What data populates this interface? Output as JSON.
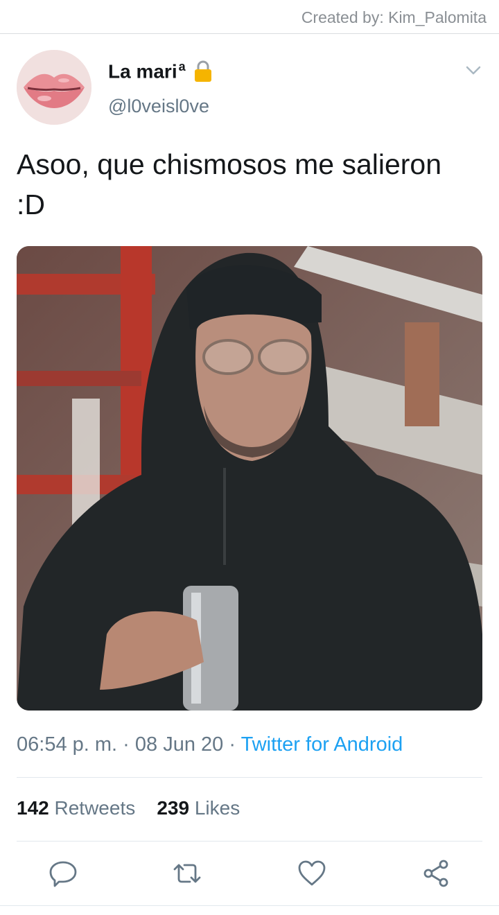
{
  "credit": "Created by: Kim_Palomita",
  "tweet": {
    "display_name": "La mari",
    "display_name_sup": "a",
    "handle": "@l0veisl0ve",
    "text": "Asoo, que chismosos me salieron :D",
    "meta": {
      "time": "06:54 p. m.",
      "separator": "·",
      "date": "08 Jun 20",
      "source": "Twitter for Android"
    },
    "stats": {
      "retweets_count": "142",
      "retweets_label": "Retweets",
      "likes_count": "239",
      "likes_label": "Likes"
    }
  },
  "icons": {
    "lock": "lock-icon",
    "menu": "chevron-down-icon",
    "reply": "reply-icon",
    "retweet": "retweet-icon",
    "like": "heart-icon",
    "share": "share-icon"
  },
  "colors": {
    "accent": "#1da1f2",
    "muted": "#657786",
    "text": "#14171a",
    "lock": "#f5b400"
  }
}
